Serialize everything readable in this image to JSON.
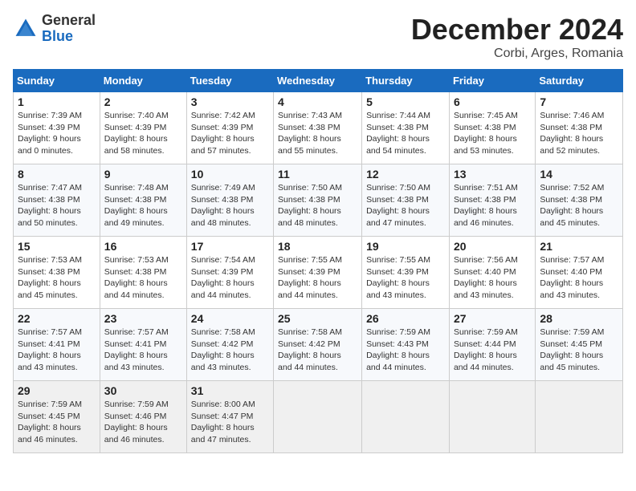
{
  "header": {
    "logo_line1": "General",
    "logo_line2": "Blue",
    "month": "December 2024",
    "location": "Corbi, Arges, Romania"
  },
  "days_of_week": [
    "Sunday",
    "Monday",
    "Tuesday",
    "Wednesday",
    "Thursday",
    "Friday",
    "Saturday"
  ],
  "weeks": [
    [
      {
        "day": "1",
        "sunrise": "7:39 AM",
        "sunset": "4:39 PM",
        "daylight": "9 hours and 0 minutes."
      },
      {
        "day": "2",
        "sunrise": "7:40 AM",
        "sunset": "4:39 PM",
        "daylight": "8 hours and 58 minutes."
      },
      {
        "day": "3",
        "sunrise": "7:42 AM",
        "sunset": "4:39 PM",
        "daylight": "8 hours and 57 minutes."
      },
      {
        "day": "4",
        "sunrise": "7:43 AM",
        "sunset": "4:38 PM",
        "daylight": "8 hours and 55 minutes."
      },
      {
        "day": "5",
        "sunrise": "7:44 AM",
        "sunset": "4:38 PM",
        "daylight": "8 hours and 54 minutes."
      },
      {
        "day": "6",
        "sunrise": "7:45 AM",
        "sunset": "4:38 PM",
        "daylight": "8 hours and 53 minutes."
      },
      {
        "day": "7",
        "sunrise": "7:46 AM",
        "sunset": "4:38 PM",
        "daylight": "8 hours and 52 minutes."
      }
    ],
    [
      {
        "day": "8",
        "sunrise": "7:47 AM",
        "sunset": "4:38 PM",
        "daylight": "8 hours and 50 minutes."
      },
      {
        "day": "9",
        "sunrise": "7:48 AM",
        "sunset": "4:38 PM",
        "daylight": "8 hours and 49 minutes."
      },
      {
        "day": "10",
        "sunrise": "7:49 AM",
        "sunset": "4:38 PM",
        "daylight": "8 hours and 48 minutes."
      },
      {
        "day": "11",
        "sunrise": "7:50 AM",
        "sunset": "4:38 PM",
        "daylight": "8 hours and 48 minutes."
      },
      {
        "day": "12",
        "sunrise": "7:50 AM",
        "sunset": "4:38 PM",
        "daylight": "8 hours and 47 minutes."
      },
      {
        "day": "13",
        "sunrise": "7:51 AM",
        "sunset": "4:38 PM",
        "daylight": "8 hours and 46 minutes."
      },
      {
        "day": "14",
        "sunrise": "7:52 AM",
        "sunset": "4:38 PM",
        "daylight": "8 hours and 45 minutes."
      }
    ],
    [
      {
        "day": "15",
        "sunrise": "7:53 AM",
        "sunset": "4:38 PM",
        "daylight": "8 hours and 45 minutes."
      },
      {
        "day": "16",
        "sunrise": "7:53 AM",
        "sunset": "4:38 PM",
        "daylight": "8 hours and 44 minutes."
      },
      {
        "day": "17",
        "sunrise": "7:54 AM",
        "sunset": "4:39 PM",
        "daylight": "8 hours and 44 minutes."
      },
      {
        "day": "18",
        "sunrise": "7:55 AM",
        "sunset": "4:39 PM",
        "daylight": "8 hours and 44 minutes."
      },
      {
        "day": "19",
        "sunrise": "7:55 AM",
        "sunset": "4:39 PM",
        "daylight": "8 hours and 43 minutes."
      },
      {
        "day": "20",
        "sunrise": "7:56 AM",
        "sunset": "4:40 PM",
        "daylight": "8 hours and 43 minutes."
      },
      {
        "day": "21",
        "sunrise": "7:57 AM",
        "sunset": "4:40 PM",
        "daylight": "8 hours and 43 minutes."
      }
    ],
    [
      {
        "day": "22",
        "sunrise": "7:57 AM",
        "sunset": "4:41 PM",
        "daylight": "8 hours and 43 minutes."
      },
      {
        "day": "23",
        "sunrise": "7:57 AM",
        "sunset": "4:41 PM",
        "daylight": "8 hours and 43 minutes."
      },
      {
        "day": "24",
        "sunrise": "7:58 AM",
        "sunset": "4:42 PM",
        "daylight": "8 hours and 43 minutes."
      },
      {
        "day": "25",
        "sunrise": "7:58 AM",
        "sunset": "4:42 PM",
        "daylight": "8 hours and 44 minutes."
      },
      {
        "day": "26",
        "sunrise": "7:59 AM",
        "sunset": "4:43 PM",
        "daylight": "8 hours and 44 minutes."
      },
      {
        "day": "27",
        "sunrise": "7:59 AM",
        "sunset": "4:44 PM",
        "daylight": "8 hours and 44 minutes."
      },
      {
        "day": "28",
        "sunrise": "7:59 AM",
        "sunset": "4:45 PM",
        "daylight": "8 hours and 45 minutes."
      }
    ],
    [
      {
        "day": "29",
        "sunrise": "7:59 AM",
        "sunset": "4:45 PM",
        "daylight": "8 hours and 46 minutes."
      },
      {
        "day": "30",
        "sunrise": "7:59 AM",
        "sunset": "4:46 PM",
        "daylight": "8 hours and 46 minutes."
      },
      {
        "day": "31",
        "sunrise": "8:00 AM",
        "sunset": "4:47 PM",
        "daylight": "8 hours and 47 minutes."
      },
      null,
      null,
      null,
      null
    ]
  ],
  "labels": {
    "sunrise_prefix": "Sunrise: ",
    "sunset_prefix": "Sunset: ",
    "daylight_prefix": "Daylight: "
  }
}
